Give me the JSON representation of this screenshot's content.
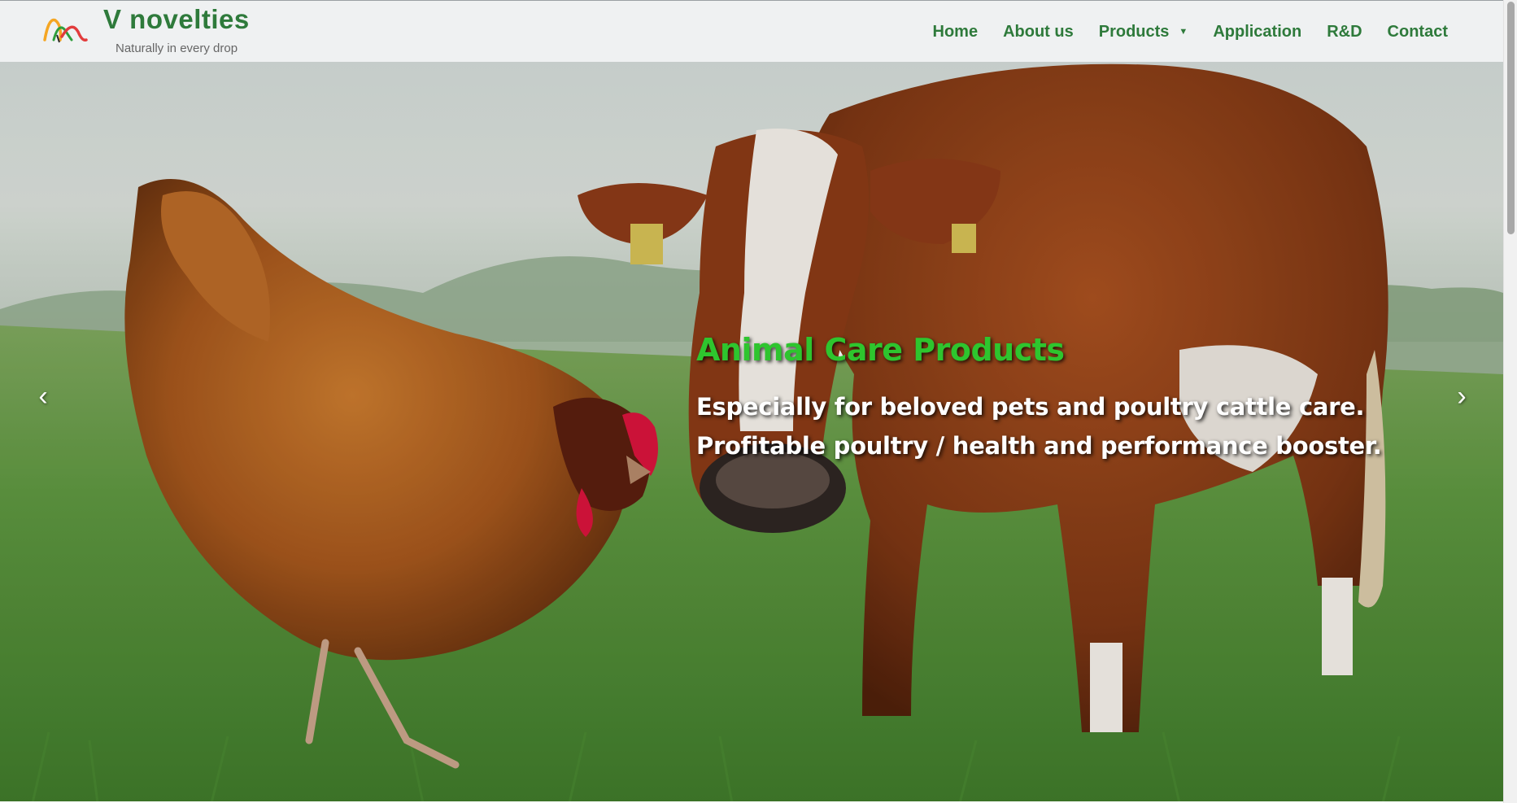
{
  "brand": {
    "name": "V novelties",
    "tagline": "Naturally in every drop"
  },
  "nav": {
    "items": [
      {
        "label": "Home"
      },
      {
        "label": "About us"
      },
      {
        "label": "Products",
        "has_dropdown": true,
        "caret": "▼"
      },
      {
        "label": "Application"
      },
      {
        "label": "R&D"
      },
      {
        "label": "Contact"
      }
    ]
  },
  "hero": {
    "title": "Animal Care Products",
    "lines": [
      "Especially for beloved pets and poultry cattle care.",
      "Profitable poultry / health and performance booster."
    ],
    "prev_arrow": "‹",
    "next_arrow": "›",
    "image": "hen-and-cow-in-grass-field"
  },
  "colors": {
    "brand_green": "#2e7a3b",
    "title_green": "#2ec52e",
    "header_bg": "#f0f3f4",
    "tagline_gray": "#666666"
  }
}
